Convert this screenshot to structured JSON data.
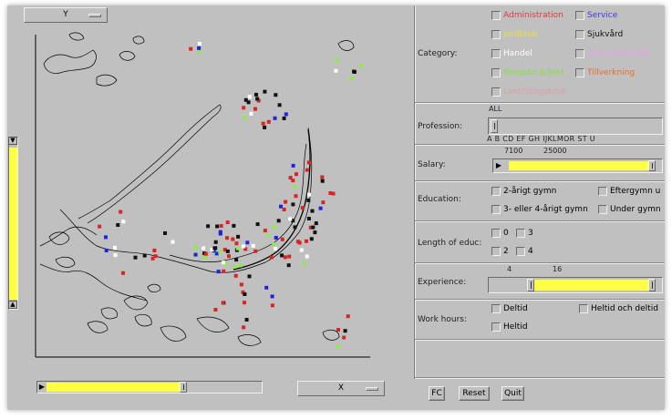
{
  "plot": {
    "y_axis_selector": "Y",
    "x_axis_selector": "X",
    "colors": {
      "administration": "#dd2222",
      "service": "#2222dd",
      "sjukvard": "#111111",
      "green": "#88ee44",
      "white": "#ffffff"
    }
  },
  "controls": {
    "category": {
      "label": "Category:",
      "options": [
        {
          "label": "Administration",
          "color": "#e03a3a"
        },
        {
          "label": "Service",
          "color": "#3a3ae0"
        },
        {
          "label": "Jordbruk",
          "color": "#e8e040"
        },
        {
          "label": "Sjukvård",
          "color": "#111111"
        },
        {
          "label": "Handel",
          "color": "#ffffff"
        },
        {
          "label": "Teknik/Samhäll",
          "color": "#e8a0e8"
        },
        {
          "label": "Skogsbruk/Jakt",
          "color": "#88dd44"
        },
        {
          "label": "Tillverkning",
          "color": "#e86a2a"
        },
        {
          "label": "Lant/Skogsbruk",
          "color": "#d8a0a0"
        }
      ]
    },
    "profession": {
      "label": "Profession:",
      "value_label": "ALL",
      "letters": "A  B      CD  EF     GH  IJKLMOR  ST  U"
    },
    "salary": {
      "label": "Salary:",
      "min": "7100",
      "max": "25000",
      "fill_start": 0.03,
      "fill_end": 0.93
    },
    "education": {
      "label": "Education:",
      "options": [
        "2-årigt gymn",
        "Eftergymn u",
        "3- eller 4-årigt gymn",
        "Under gymn"
      ]
    },
    "length_educ": {
      "label": "Length of educ:",
      "options": [
        "0",
        "3",
        "2",
        "4"
      ]
    },
    "experience": {
      "label": "Experience:",
      "min": "4",
      "max": "16",
      "fill_start": 0.26,
      "fill_end": 0.97
    },
    "work_hours": {
      "label": "Work hours:",
      "options": [
        "Deltid",
        "Heltid och deltid",
        "Heltid"
      ]
    }
  },
  "buttons": {
    "fc": "FC",
    "reset": "Reset",
    "quit": "Quit"
  },
  "sliders": {
    "x_range_fill": 0.62,
    "y_range_start": 0.06,
    "y_range_end": 0.95
  }
}
